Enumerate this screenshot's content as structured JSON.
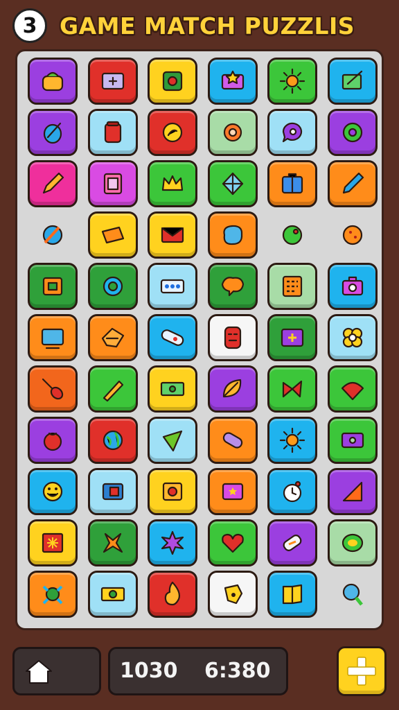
{
  "header": {
    "level": "3",
    "title": "GAME MATCH PUZZLIS"
  },
  "footer": {
    "score": "1030",
    "timer": "6:380"
  },
  "colors": {
    "purple": "#9b3fe0",
    "red": "#e0302a",
    "yellow": "#ffd21f",
    "sky": "#1fb3ee",
    "green": "#3cc63a",
    "pink": "#ef2f9c",
    "magenta": "#d94be3",
    "orange": "#ff8c1a",
    "darkorange": "#f2661c",
    "lightblue": "#9fe0f6",
    "mint": "#a8dca7",
    "darkgreen": "#2fa03a",
    "white": "#f6f6f6",
    "board": "#d7d7d7",
    "frame": "#5a2e22"
  },
  "tiles": [
    {
      "color": "purple",
      "icon": "pot-icon"
    },
    {
      "color": "red",
      "icon": "screen-icon"
    },
    {
      "color": "yellow",
      "icon": "button-icon"
    },
    {
      "color": "sky",
      "icon": "star-card-icon"
    },
    {
      "color": "green",
      "icon": "sun-icon"
    },
    {
      "color": "sky",
      "icon": "easel-icon"
    },
    {
      "color": "purple",
      "icon": "brush-egg-icon"
    },
    {
      "color": "lightblue",
      "icon": "jar-icon"
    },
    {
      "color": "red",
      "icon": "cookie-icon"
    },
    {
      "color": "mint",
      "icon": "gear-icon"
    },
    {
      "color": "lightblue",
      "icon": "chat-bubble-icon"
    },
    {
      "color": "purple",
      "icon": "donut-icon"
    },
    {
      "color": "pink",
      "icon": "pencil-icon"
    },
    {
      "color": "magenta",
      "icon": "frame-icon"
    },
    {
      "color": "green",
      "icon": "crown-icon"
    },
    {
      "color": "green",
      "icon": "gem-icon"
    },
    {
      "color": "orange",
      "icon": "suitcase-icon"
    },
    {
      "color": "orange",
      "icon": "crayon-icon"
    },
    {
      "color": "none",
      "icon": "pen-ball-icon"
    },
    {
      "color": "yellow",
      "icon": "tag-icon"
    },
    {
      "color": "yellow",
      "icon": "envelope-icon"
    },
    {
      "color": "orange",
      "icon": "blob-icon"
    },
    {
      "color": "none",
      "icon": "green-ball-icon"
    },
    {
      "color": "none",
      "icon": "orange-ball-icon"
    },
    {
      "color": "darkgreen",
      "icon": "box-icon"
    },
    {
      "color": "darkgreen",
      "icon": "ring-icon"
    },
    {
      "color": "lightblue",
      "icon": "radio-icon"
    },
    {
      "color": "darkgreen",
      "icon": "speech-icon"
    },
    {
      "color": "mint",
      "icon": "keypad-icon"
    },
    {
      "color": "sky",
      "icon": "camera-icon"
    },
    {
      "color": "orange",
      "icon": "monitor-icon"
    },
    {
      "color": "orange",
      "icon": "fish-icon"
    },
    {
      "color": "sky",
      "icon": "capsule-icon"
    },
    {
      "color": "white",
      "icon": "totem-icon"
    },
    {
      "color": "darkgreen",
      "icon": "plus-box-icon"
    },
    {
      "color": "lightblue",
      "icon": "flower-icon"
    },
    {
      "color": "darkorange",
      "icon": "racket-icon"
    },
    {
      "color": "green",
      "icon": "wand-icon"
    },
    {
      "color": "yellow",
      "icon": "banknote-icon"
    },
    {
      "color": "purple",
      "icon": "leaf-icon"
    },
    {
      "color": "green",
      "icon": "bow-icon"
    },
    {
      "color": "green",
      "icon": "spinning-top-icon"
    },
    {
      "color": "purple",
      "icon": "tomato-icon"
    },
    {
      "color": "red",
      "icon": "globe-icon"
    },
    {
      "color": "lightblue",
      "icon": "cone-icon"
    },
    {
      "color": "orange",
      "icon": "clip-icon"
    },
    {
      "color": "sky",
      "icon": "sunflower-icon"
    },
    {
      "color": "green",
      "icon": "tape-icon"
    },
    {
      "color": "sky",
      "icon": "smiley-icon"
    },
    {
      "color": "lightblue",
      "icon": "card-icon"
    },
    {
      "color": "yellow",
      "icon": "apple-box-icon"
    },
    {
      "color": "orange",
      "icon": "star-frame-icon"
    },
    {
      "color": "sky",
      "icon": "clock-icon"
    },
    {
      "color": "purple",
      "icon": "triangle-ruler-icon"
    },
    {
      "color": "yellow",
      "icon": "sparkle-box-icon"
    },
    {
      "color": "darkgreen",
      "icon": "cross-icon"
    },
    {
      "color": "sky",
      "icon": "flower-star-icon"
    },
    {
      "color": "green",
      "icon": "heart-icon"
    },
    {
      "color": "purple",
      "icon": "scroll-icon"
    },
    {
      "color": "mint",
      "icon": "kiwi-icon"
    },
    {
      "color": "orange",
      "icon": "turtle-icon"
    },
    {
      "color": "lightblue",
      "icon": "cash-icon"
    },
    {
      "color": "red",
      "icon": "flame-icon"
    },
    {
      "color": "white",
      "icon": "whistle-icon"
    },
    {
      "color": "sky",
      "icon": "book-icon"
    },
    {
      "color": "none",
      "icon": "balloon-icon"
    }
  ]
}
